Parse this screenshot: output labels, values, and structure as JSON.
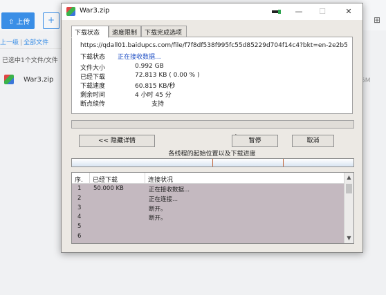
{
  "background": {
    "upload_button": "上传",
    "breadcrumb": {
      "back": "上一级",
      "separator": "|",
      "root": "全部文件"
    },
    "selection_text": "已选中1个文件/文件",
    "file_name": "War3.zip",
    "side_text": "5M"
  },
  "window": {
    "title": "War3.zip",
    "tabs": [
      {
        "label": "下载状态",
        "active": true
      },
      {
        "label": "速度限制",
        "active": false
      },
      {
        "label": "下载完成选项",
        "active": false
      }
    ],
    "url": "https://qdall01.baidupcs.com/file/f7f8df538f995fc55d85229d704f14c4?bkt=en-2e2b5",
    "status_label": "下载状态",
    "status_value": "正在接收数据...",
    "info": [
      {
        "label": "文件大小",
        "value": "0.992  GB"
      },
      {
        "label": "已经下载",
        "value": "72.813  KB  ( 0.00 % )"
      },
      {
        "label": "下载速度",
        "value": "60.815  KB/秒"
      },
      {
        "label": "剩余时间",
        "value": "4 小时 45 分"
      },
      {
        "label": "断点续传",
        "value": "支持"
      }
    ],
    "overall_progress": 0.0,
    "buttons": {
      "hide_details": "<< 隐藏详情",
      "pause": "暂停",
      "cancel": "取消"
    },
    "threads_label": "各线程的起始位置以及下载进度",
    "table": {
      "headers": [
        "序.",
        "已经下载",
        "连接状况"
      ],
      "rows": [
        {
          "n": "1",
          "downloaded": "50.000  KB",
          "status": "正在接收数据..."
        },
        {
          "n": "2",
          "downloaded": "",
          "status": "正在连接..."
        },
        {
          "n": "3",
          "downloaded": "",
          "status": "断开。"
        },
        {
          "n": "4",
          "downloaded": "",
          "status": "断开。"
        },
        {
          "n": "5",
          "downloaded": "",
          "status": ""
        },
        {
          "n": "6",
          "downloaded": "",
          "status": ""
        }
      ]
    }
  }
}
